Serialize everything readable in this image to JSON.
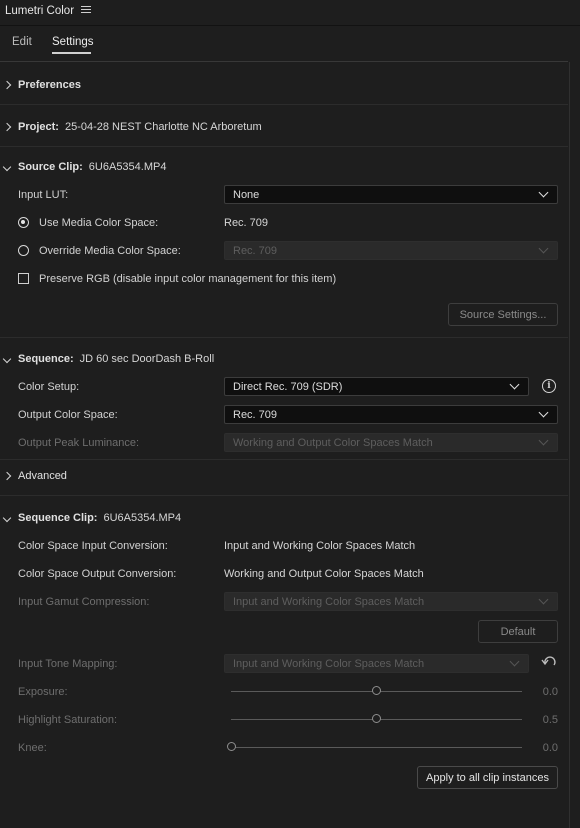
{
  "panel": {
    "title": "Lumetri Color"
  },
  "tabs": [
    {
      "label": "Edit",
      "active": false
    },
    {
      "label": "Settings",
      "active": true
    }
  ],
  "preferences": {
    "label": "Preferences"
  },
  "project": {
    "label": "Project:",
    "value": "25-04-28 NEST Charlotte NC Arboretum"
  },
  "source_clip": {
    "label": "Source Clip:",
    "value": "6U6A5354.MP4",
    "input_lut": {
      "label": "Input LUT:",
      "value": "None"
    },
    "use_media": {
      "label": "Use Media Color Space:",
      "value": "Rec. 709",
      "selected": true
    },
    "override_media": {
      "label": "Override Media Color Space:",
      "value": "Rec. 709",
      "selected": false
    },
    "preserve_rgb": {
      "label": "Preserve RGB (disable input color management for this item)",
      "checked": false
    },
    "source_settings_button": "Source Settings..."
  },
  "sequence": {
    "label": "Sequence:",
    "value": "JD 60 sec DoorDash B-Roll",
    "color_setup": {
      "label": "Color Setup:",
      "value": "Direct Rec. 709 (SDR)"
    },
    "output_color_space": {
      "label": "Output Color Space:",
      "value": "Rec. 709"
    },
    "output_peak_luminance": {
      "label": "Output Peak Luminance:",
      "value": "Working and Output Color Spaces Match"
    }
  },
  "advanced": {
    "label": "Advanced"
  },
  "sequence_clip": {
    "label": "Sequence Clip:",
    "value": "6U6A5354.MP4",
    "input_conversion": {
      "label": "Color Space Input Conversion:",
      "value": "Input and Working Color Spaces Match"
    },
    "output_conversion": {
      "label": "Color Space Output Conversion:",
      "value": "Working and Output Color Spaces Match"
    },
    "gamut_compression": {
      "label": "Input Gamut Compression:",
      "value": "Input and Working Color Spaces Match"
    },
    "default_button": "Default",
    "tone_mapping": {
      "label": "Input Tone Mapping:",
      "value": "Input and Working Color Spaces Match"
    },
    "exposure": {
      "label": "Exposure:",
      "value": "0.0",
      "level": 0.5
    },
    "highlight_saturation": {
      "label": "Highlight Saturation:",
      "value": "0.5",
      "level": 0.5
    },
    "knee": {
      "label": "Knee:",
      "value": "0.0",
      "level": 0.0
    },
    "apply_button": "Apply to all clip instances"
  },
  "icons": {
    "menu": "hamburger-menu-icon",
    "info": "info-icon",
    "reset": "reset-icon"
  }
}
